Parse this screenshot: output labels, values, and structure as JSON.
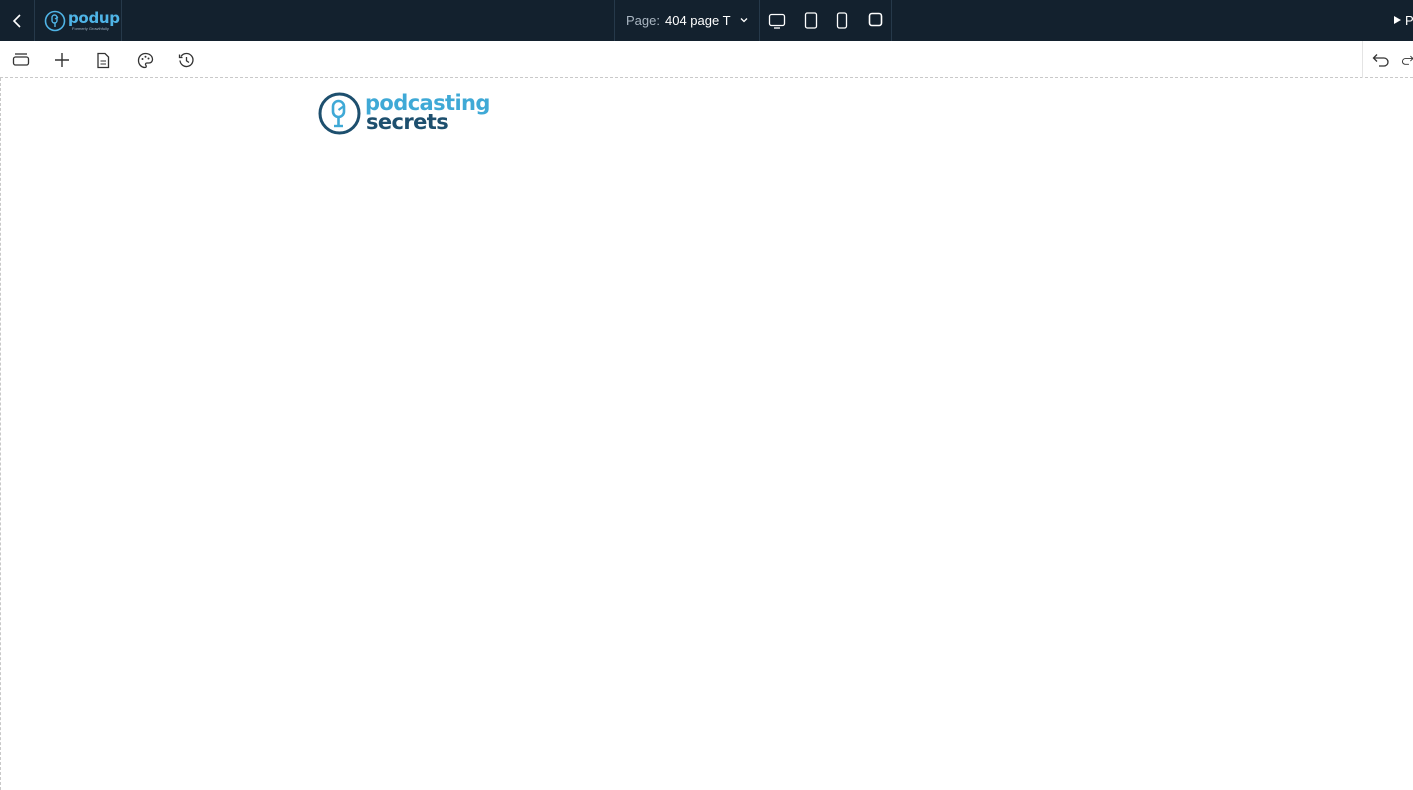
{
  "topbar": {
    "logo_text": "podup",
    "logo_tagline": "Formerly Growthfully",
    "page_label": "Page:",
    "page_value": "404 page T",
    "preview_label": "P"
  },
  "devices": [
    "desktop-icon",
    "tablet-icon",
    "mobile-icon",
    "square-view-icon"
  ],
  "toolbar": [
    "layers-icon",
    "add-icon",
    "page-icon",
    "palette-icon",
    "history-icon"
  ],
  "canvas": {
    "logo_line1": "podcasting",
    "logo_line2": "secrets"
  },
  "colors": {
    "topbar_bg": "#13212e",
    "brand_light": "#3fa9d6",
    "brand_dark": "#1d4f6e"
  }
}
